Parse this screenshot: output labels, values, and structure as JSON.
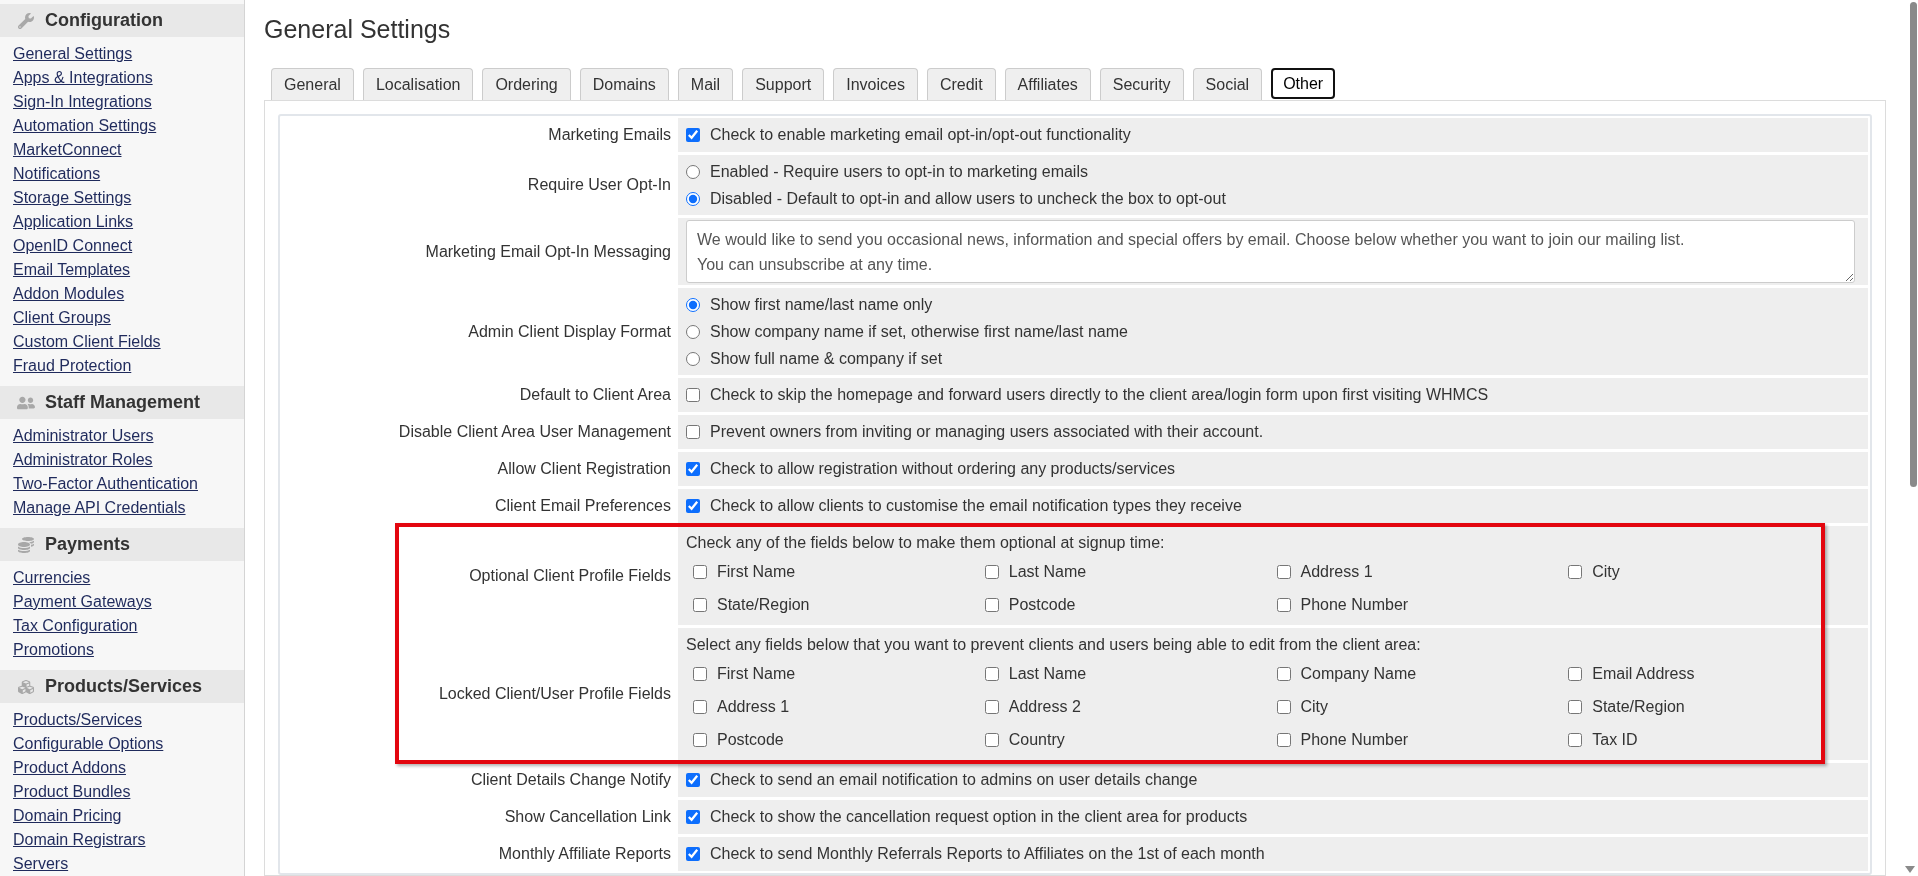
{
  "sidebar": {
    "sections": [
      {
        "title": "Configuration",
        "links": [
          "General Settings",
          "Apps & Integrations",
          "Sign-In Integrations",
          "Automation Settings",
          "MarketConnect",
          "Notifications",
          "Storage Settings",
          "Application Links",
          "OpenID Connect",
          "Email Templates",
          "Addon Modules",
          "Client Groups",
          "Custom Client Fields",
          "Fraud Protection"
        ]
      },
      {
        "title": "Staff Management",
        "links": [
          "Administrator Users",
          "Administrator Roles",
          "Two-Factor Authentication",
          "Manage API Credentials"
        ]
      },
      {
        "title": "Payments",
        "links": [
          "Currencies",
          "Payment Gateways",
          "Tax Configuration",
          "Promotions"
        ]
      },
      {
        "title": "Products/Services",
        "links": [
          "Products/Services",
          "Configurable Options",
          "Product Addons",
          "Product Bundles",
          "Domain Pricing",
          "Domain Registrars",
          "Servers"
        ]
      }
    ]
  },
  "page": {
    "title": "General Settings"
  },
  "tabs": [
    {
      "label": "General",
      "selected": false
    },
    {
      "label": "Localisation",
      "selected": false
    },
    {
      "label": "Ordering",
      "selected": false
    },
    {
      "label": "Domains",
      "selected": false
    },
    {
      "label": "Mail",
      "selected": false
    },
    {
      "label": "Support",
      "selected": false
    },
    {
      "label": "Invoices",
      "selected": false
    },
    {
      "label": "Credit",
      "selected": false
    },
    {
      "label": "Affiliates",
      "selected": false
    },
    {
      "label": "Security",
      "selected": false
    },
    {
      "label": "Social",
      "selected": false
    },
    {
      "label": "Other",
      "selected": true
    }
  ],
  "settings": [
    {
      "kind": "checkbox",
      "label": "Marketing Emails",
      "checked": true,
      "text": "Check to enable marketing email opt-in/opt-out functionality",
      "highlighted": false
    },
    {
      "kind": "radio",
      "label": "Require User Opt-In",
      "options": [
        {
          "text": "Enabled - Require users to opt-in to marketing emails",
          "selected": false
        },
        {
          "text": "Disabled - Default to opt-in and allow users to uncheck the box to opt-out",
          "selected": true
        }
      ],
      "highlighted": false
    },
    {
      "kind": "textarea",
      "label": "Marketing Email Opt-In Messaging",
      "value": "We would like to send you occasional news, information and special offers by email. Choose below whether you want to join our mailing list.\nYou can unsubscribe at any time.",
      "highlighted": false
    },
    {
      "kind": "radio",
      "label": "Admin Client Display Format",
      "options": [
        {
          "text": "Show first name/last name only",
          "selected": true
        },
        {
          "text": "Show company name if set, otherwise first name/last name",
          "selected": false
        },
        {
          "text": "Show full name & company if set",
          "selected": false
        }
      ],
      "highlighted": false
    },
    {
      "kind": "checkbox",
      "label": "Default to Client Area",
      "checked": false,
      "text": "Check to skip the homepage and forward users directly to the client area/login form upon first visiting WHMCS",
      "highlighted": false
    },
    {
      "kind": "checkbox",
      "label": "Disable Client Area User Management",
      "checked": false,
      "text": "Prevent owners from inviting or managing users associated with their account.",
      "highlighted": false
    },
    {
      "kind": "checkbox",
      "label": "Allow Client Registration",
      "checked": true,
      "text": "Check to allow registration without ordering any products/services",
      "highlighted": false
    },
    {
      "kind": "checkbox",
      "label": "Client Email Preferences",
      "checked": true,
      "text": "Check to allow clients to customise the email notification types they receive",
      "highlighted": false
    },
    {
      "kind": "checkbox_grid",
      "label": "Optional Client Profile Fields",
      "intro": "Check any of the fields below to make them optional at signup time:",
      "fields": [
        {
          "label": "First Name",
          "checked": false
        },
        {
          "label": "Last Name",
          "checked": false
        },
        {
          "label": "Address 1",
          "checked": false
        },
        {
          "label": "City",
          "checked": false
        },
        {
          "label": "State/Region",
          "checked": false
        },
        {
          "label": "Postcode",
          "checked": false
        },
        {
          "label": "Phone Number",
          "checked": false
        }
      ],
      "highlighted": true
    },
    {
      "kind": "checkbox_grid",
      "label": "Locked Client/User Profile Fields",
      "intro": "Select any fields below that you want to prevent clients and users being able to edit from the client area:",
      "fields": [
        {
          "label": "First Name",
          "checked": false
        },
        {
          "label": "Last Name",
          "checked": false
        },
        {
          "label": "Company Name",
          "checked": false
        },
        {
          "label": "Email Address",
          "checked": false
        },
        {
          "label": "Address 1",
          "checked": false
        },
        {
          "label": "Address 2",
          "checked": false
        },
        {
          "label": "City",
          "checked": false
        },
        {
          "label": "State/Region",
          "checked": false
        },
        {
          "label": "Postcode",
          "checked": false
        },
        {
          "label": "Country",
          "checked": false
        },
        {
          "label": "Phone Number",
          "checked": false
        },
        {
          "label": "Tax ID",
          "checked": false
        }
      ],
      "highlighted": true
    },
    {
      "kind": "checkbox",
      "label": "Client Details Change Notify",
      "checked": true,
      "text": "Check to send an email notification to admins on user details change",
      "highlighted": false
    },
    {
      "kind": "checkbox",
      "label": "Show Cancellation Link",
      "checked": true,
      "text": "Check to show the cancellation request option in the client area for products",
      "highlighted": false
    },
    {
      "kind": "checkbox",
      "label": "Monthly Affiliate Reports",
      "checked": true,
      "text": "Check to send Monthly Referrals Reports to Affiliates on the 1st of each month",
      "highlighted": false
    }
  ]
}
